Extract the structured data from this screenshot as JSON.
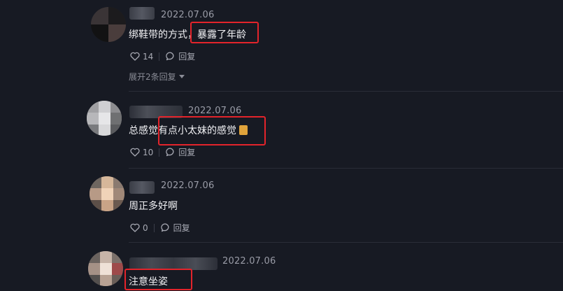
{
  "comments": [
    {
      "date": "2022.07.06",
      "text_prefix": "绑鞋带的方式，",
      "text_highlight": "暴露了年龄",
      "likes": "14",
      "reply_label": "回复",
      "expand_label": "展开2条回复"
    },
    {
      "date": "2022.07.06",
      "text_prefix": "总感觉",
      "text_highlight": "有点小太妹的感觉",
      "likes": "10",
      "reply_label": "回复"
    },
    {
      "date": "2022.07.06",
      "text_prefix": "周正多好啊",
      "likes": "0",
      "reply_label": "回复"
    },
    {
      "date": "2022.07.06",
      "text_highlight": "注意坐姿"
    }
  ],
  "icons": {
    "like": "heart-outline-icon",
    "reply": "speech-bubble-icon",
    "expand": "caret-down-icon"
  },
  "colors": {
    "background": "#171a23",
    "highlight_box": "#e3242b"
  }
}
